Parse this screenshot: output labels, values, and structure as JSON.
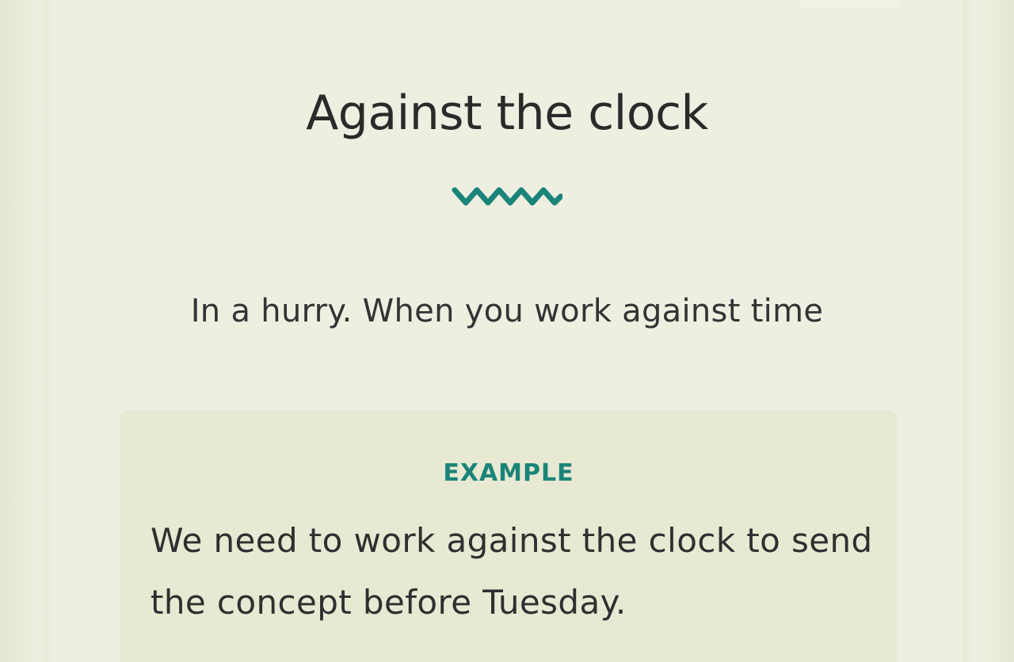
{
  "card": {
    "title": "Against the clock",
    "definition": "In a hurry. When you work against time",
    "divider_icon": "wave-divider-icon",
    "example": {
      "label": "EXAMPLE",
      "text": "We need to work against the clock to send the concept before Tuesday."
    }
  },
  "colors": {
    "background": "#e8ead6",
    "card": "#eeefe1",
    "example_box": "#e7e9d3",
    "accent": "#1b8478",
    "text": "#2a2a2a"
  }
}
